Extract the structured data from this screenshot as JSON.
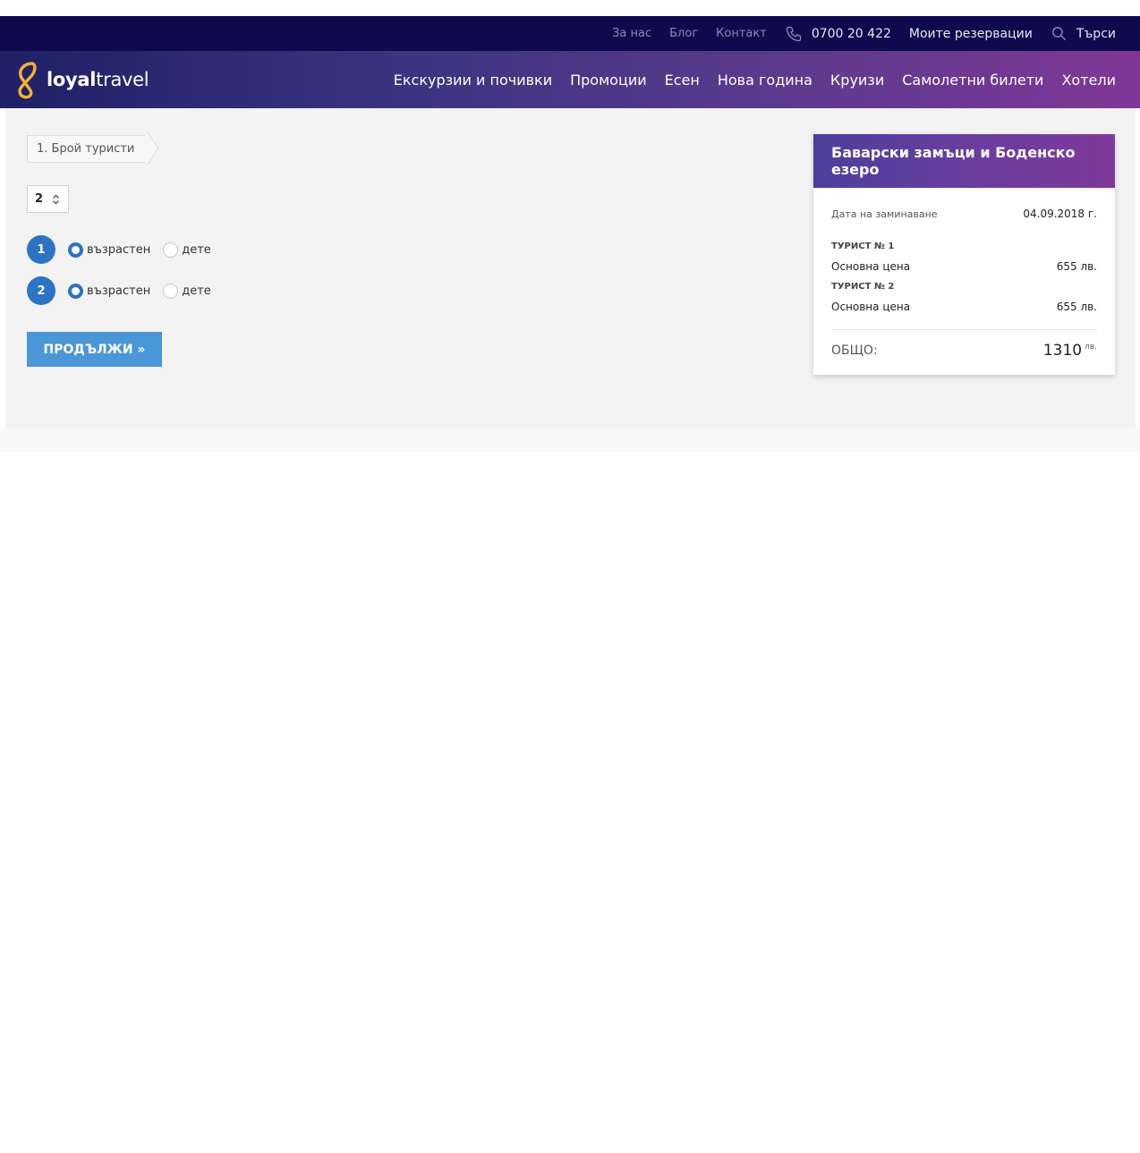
{
  "topbar": {
    "links": [
      "За нас",
      "Блог",
      "Контакт"
    ],
    "phone": "0700 20 422",
    "my_reservations": "Моите резервации",
    "search": "Търси",
    "bg_color": "#0d0b4d"
  },
  "brand": {
    "logo_bold": "loyal",
    "logo_light": "travel",
    "logo_accent": "#f2b134"
  },
  "nav": {
    "items": [
      "Екскурзии и почивки",
      "Промоции",
      "Есен",
      "Нова година",
      "Круизи",
      "Самолетни билети",
      "Хотели"
    ]
  },
  "form": {
    "step_label": "1.  Брой туристи",
    "tourist_count": "2",
    "tourists": [
      {
        "number": "1",
        "options": [
          "възрастен",
          "дете"
        ],
        "selected": "възрастен"
      },
      {
        "number": "2",
        "options": [
          "възрастен",
          "дете"
        ],
        "selected": "възрастен"
      }
    ],
    "continue_label": "ПРОДЪЛЖИ »",
    "accent": "#2c74c3",
    "button_color": "#4a96d6"
  },
  "summary": {
    "title": "Баварски замъци и Боденско езеро",
    "departure_label": "Дата на заминаване",
    "departure_value": "04.09.2018 г.",
    "tourists": [
      {
        "label": "ТУРИСТ № 1",
        "price_label": "Основна цена",
        "price": "655 лв."
      },
      {
        "label": "ТУРИСТ № 2",
        "price_label": "Основна цена",
        "price": "655 лв."
      }
    ],
    "total_label": "ОБЩО:",
    "total_value": "1310",
    "total_currency": "лв."
  }
}
